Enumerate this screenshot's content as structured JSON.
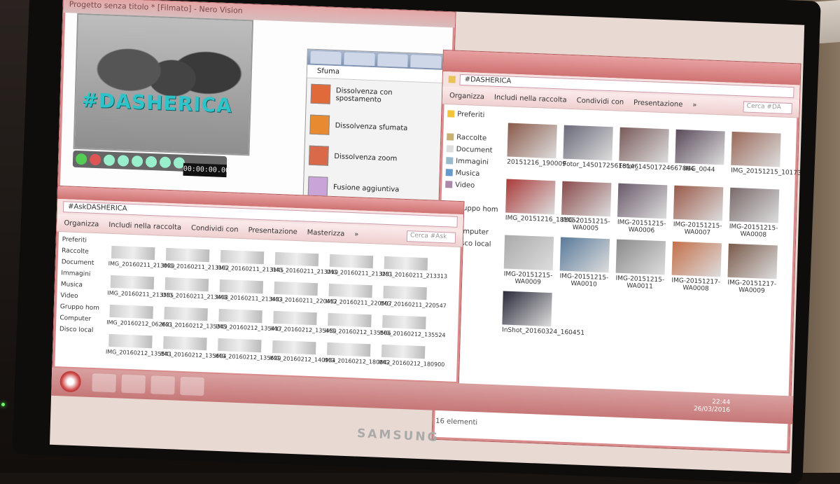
{
  "nero": {
    "title": "Progetto senza titolo * [Filmato] - Nero Vision",
    "overlay_text": "#DASHERICA",
    "timecode": "00:00:00.00",
    "panel_header": "Sfuma",
    "effects": [
      {
        "label": "Dissolvenza con spostamento",
        "color": "#e06a3a"
      },
      {
        "label": "Dissolvenza sfumata",
        "color": "#e88a30"
      },
      {
        "label": "Dissolvenza zoom",
        "color": "#d86a4a"
      },
      {
        "label": "Fusione aggiuntiva",
        "color": "#c9a4d8"
      }
    ]
  },
  "explorer_right": {
    "path": "#DASHERICA",
    "search_placeholder": "Cerca #DA",
    "toolbar": [
      "Organizza",
      "Includi nella raccolta",
      "Condividi con",
      "Presentazione",
      "»"
    ],
    "nav": [
      "Preferiti",
      "Raccolte",
      "Document",
      "Immagini",
      "Musica",
      "Video",
      "Gruppo hom",
      "Computer",
      "Disco local"
    ],
    "files": [
      "20151216_190009",
      "Fotor_14501725618146",
      "Fotor_14501724667864",
      "IMG_0044",
      "IMG_20151215_101735",
      "IMG_20151216_181052",
      "IMG-20151215-WA0005",
      "IMG-20151215-WA0006",
      "IMG-20151215-WA0007",
      "IMG-20151215-WA0008",
      "IMG-20151215-WA0009",
      "IMG-20151215-WA0010",
      "IMG-20151215-WA0011",
      "IMG-20151217-WA0008",
      "IMG-20151217-WA0009",
      "InShot_20160324_160451"
    ],
    "status": "16 elementi"
  },
  "explorer_left": {
    "path": "#AskDASHERICA",
    "search_placeholder": "Cerca #Ask",
    "toolbar": [
      "Organizza",
      "Includi nella raccolta",
      "Condividi con",
      "Presentazione",
      "Masterizza",
      "»"
    ],
    "nav": [
      "Preferiti",
      "Raccolte",
      "Document",
      "Immagini",
      "Musica",
      "Video",
      "Gruppo hom",
      "Computer",
      "Disco local"
    ],
    "files": [
      "IMG_20160211_213020",
      "IMG_20160211_213102",
      "IMG_20160211_213145",
      "IMG_20160211_213210",
      "IMG_20160211_213231",
      "IMG_20160211_213313",
      "IMG_20160211_213335",
      "IMG_20160211_213408",
      "IMG_20160211_213433",
      "IMG_20160211_220452",
      "IMG_20160211_220507",
      "IMG_20160211_220547",
      "IMG_20160212_062621",
      "IMG_20160212_135349",
      "IMG_20160212_135417",
      "IMG_20160212_135450",
      "IMG_20160212_135506",
      "IMG_20160212_135524",
      "IMG_20160212_135541",
      "IMG_20160212_135604",
      "IMG_20160212_135620",
      "IMG_20160212_140934",
      "IMG_20160212_180842",
      "IMG_20160212_180900"
    ]
  },
  "taskbar": {
    "time": "22:44",
    "date": "26/03/2016"
  },
  "monitor": {
    "brand": "SAMSUNG"
  }
}
